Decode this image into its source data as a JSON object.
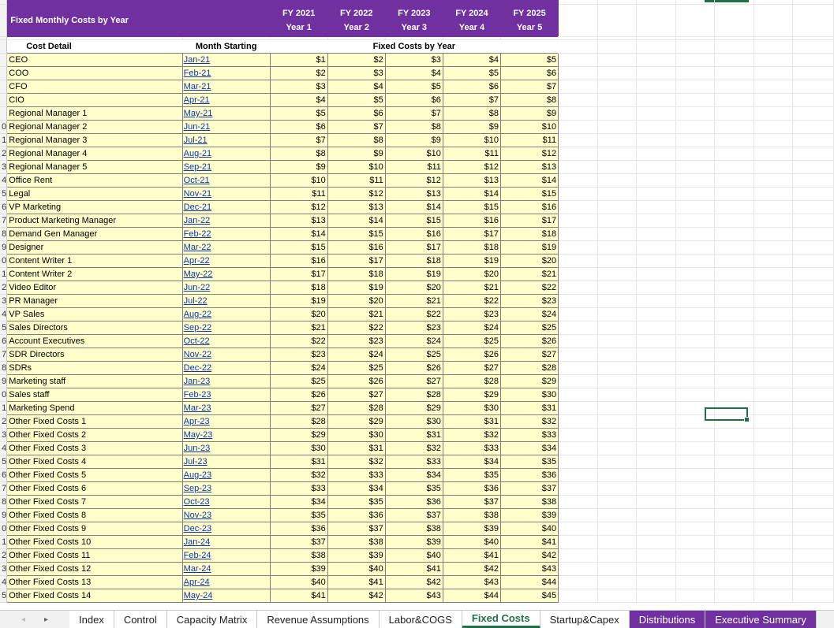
{
  "header": {
    "title": "Fixed Monthly Costs by Year",
    "fy": [
      "FY 2021",
      "FY 2022",
      "FY 2023",
      "FY 2024",
      "FY 2025"
    ],
    "years": [
      "Year 1",
      "Year 2",
      "Year 3",
      "Year 4",
      "Year 5"
    ]
  },
  "subheader": {
    "cost_detail": "Cost Detail",
    "month_starting": "Month Starting",
    "fixed_costs_by_year": "Fixed Costs by Year"
  },
  "row_numbers": [
    "",
    "",
    "",
    "",
    "",
    "",
    "",
    "0",
    "1",
    "2",
    "3",
    "4",
    "5",
    "6",
    "7",
    "8",
    "9",
    "0",
    "1",
    "2",
    "3",
    "4",
    "5",
    "6",
    "7",
    "8",
    "9",
    "0",
    "1",
    "2",
    "3",
    "4",
    "5",
    "6",
    "7",
    "8",
    "9",
    "0",
    "1",
    "2",
    "3",
    "4",
    "5"
  ],
  "rows": [
    {
      "label": "CEO",
      "month": "Jan-21",
      "v": [
        "$1",
        "$2",
        "$3",
        "$4",
        "$5"
      ]
    },
    {
      "label": "COO",
      "month": "Feb-21",
      "v": [
        "$2",
        "$3",
        "$4",
        "$5",
        "$6"
      ]
    },
    {
      "label": "CFO",
      "month": "Mar-21",
      "v": [
        "$3",
        "$4",
        "$5",
        "$6",
        "$7"
      ]
    },
    {
      "label": "CIO",
      "month": "Apr-21",
      "v": [
        "$4",
        "$5",
        "$6",
        "$7",
        "$8"
      ]
    },
    {
      "label": "Regional Manager 1",
      "month": "May-21",
      "v": [
        "$5",
        "$6",
        "$7",
        "$8",
        "$9"
      ]
    },
    {
      "label": "Regional Manager 2",
      "month": "Jun-21",
      "v": [
        "$6",
        "$7",
        "$8",
        "$9",
        "$10"
      ]
    },
    {
      "label": "Regional Manager 3",
      "month": "Jul-21",
      "v": [
        "$7",
        "$8",
        "$9",
        "$10",
        "$11"
      ]
    },
    {
      "label": "Regional Manager 4",
      "month": "Aug-21",
      "v": [
        "$8",
        "$9",
        "$10",
        "$11",
        "$12"
      ]
    },
    {
      "label": "Regional Manager 5",
      "month": "Sep-21",
      "v": [
        "$9",
        "$10",
        "$11",
        "$12",
        "$13"
      ]
    },
    {
      "label": "Office Rent",
      "month": "Oct-21",
      "v": [
        "$10",
        "$11",
        "$12",
        "$13",
        "$14"
      ]
    },
    {
      "label": "Legal",
      "month": "Nov-21",
      "v": [
        "$11",
        "$12",
        "$13",
        "$14",
        "$15"
      ]
    },
    {
      "label": "VP Marketing",
      "month": "Dec-21",
      "v": [
        "$12",
        "$13",
        "$14",
        "$15",
        "$16"
      ]
    },
    {
      "label": "Product Marketing Manager",
      "month": "Jan-22",
      "v": [
        "$13",
        "$14",
        "$15",
        "$16",
        "$17"
      ]
    },
    {
      "label": "Demand Gen Manager",
      "month": "Feb-22",
      "v": [
        "$14",
        "$15",
        "$16",
        "$17",
        "$18"
      ]
    },
    {
      "label": "Designer",
      "month": "Mar-22",
      "v": [
        "$15",
        "$16",
        "$17",
        "$18",
        "$19"
      ]
    },
    {
      "label": "Content Writer 1",
      "month": "Apr-22",
      "v": [
        "$16",
        "$17",
        "$18",
        "$19",
        "$20"
      ]
    },
    {
      "label": "Content Writer 2",
      "month": "May-22",
      "v": [
        "$17",
        "$18",
        "$19",
        "$20",
        "$21"
      ]
    },
    {
      "label": "Video Editor",
      "month": "Jun-22",
      "v": [
        "$18",
        "$19",
        "$20",
        "$21",
        "$22"
      ]
    },
    {
      "label": "PR Manager",
      "month": "Jul-22",
      "v": [
        "$19",
        "$20",
        "$21",
        "$22",
        "$23"
      ]
    },
    {
      "label": "VP Sales",
      "month": "Aug-22",
      "v": [
        "$20",
        "$21",
        "$22",
        "$23",
        "$24"
      ]
    },
    {
      "label": "Sales Directors",
      "month": "Sep-22",
      "v": [
        "$21",
        "$22",
        "$23",
        "$24",
        "$25"
      ]
    },
    {
      "label": "Account Executives",
      "month": "Oct-22",
      "v": [
        "$22",
        "$23",
        "$24",
        "$25",
        "$26"
      ]
    },
    {
      "label": "SDR Directors",
      "month": "Nov-22",
      "v": [
        "$23",
        "$24",
        "$25",
        "$26",
        "$27"
      ]
    },
    {
      "label": "SDRs",
      "month": "Dec-22",
      "v": [
        "$24",
        "$25",
        "$26",
        "$27",
        "$28"
      ]
    },
    {
      "label": "Marketing staff",
      "month": "Jan-23",
      "v": [
        "$25",
        "$26",
        "$27",
        "$28",
        "$29"
      ]
    },
    {
      "label": "Sales staff",
      "month": "Feb-23",
      "v": [
        "$26",
        "$27",
        "$28",
        "$29",
        "$30"
      ]
    },
    {
      "label": "Marketing Spend",
      "month": "Mar-23",
      "v": [
        "$27",
        "$28",
        "$29",
        "$30",
        "$31"
      ]
    },
    {
      "label": "Other Fixed Costs 1",
      "month": "Apr-23",
      "v": [
        "$28",
        "$29",
        "$30",
        "$31",
        "$32"
      ]
    },
    {
      "label": "Other Fixed Costs 2",
      "month": "May-23",
      "v": [
        "$29",
        "$30",
        "$31",
        "$32",
        "$33"
      ]
    },
    {
      "label": "Other Fixed Costs 3",
      "month": "Jun-23",
      "v": [
        "$30",
        "$31",
        "$32",
        "$33",
        "$34"
      ]
    },
    {
      "label": "Other Fixed Costs 4",
      "month": "Jul-23",
      "v": [
        "$31",
        "$32",
        "$33",
        "$34",
        "$35"
      ]
    },
    {
      "label": "Other Fixed Costs 5",
      "month": "Aug-23",
      "v": [
        "$32",
        "$33",
        "$34",
        "$35",
        "$36"
      ]
    },
    {
      "label": "Other Fixed Costs 6",
      "month": "Sep-23",
      "v": [
        "$33",
        "$34",
        "$35",
        "$36",
        "$37"
      ]
    },
    {
      "label": "Other Fixed Costs 7",
      "month": "Oct-23",
      "v": [
        "$34",
        "$35",
        "$36",
        "$37",
        "$38"
      ]
    },
    {
      "label": "Other Fixed Costs 8",
      "month": "Nov-23",
      "v": [
        "$35",
        "$36",
        "$37",
        "$38",
        "$39"
      ]
    },
    {
      "label": "Other Fixed Costs 9",
      "month": "Dec-23",
      "v": [
        "$36",
        "$37",
        "$38",
        "$39",
        "$40"
      ]
    },
    {
      "label": "Other Fixed Costs 10",
      "month": "Jan-24",
      "v": [
        "$37",
        "$38",
        "$39",
        "$40",
        "$41"
      ]
    },
    {
      "label": "Other Fixed Costs 11",
      "month": "Feb-24",
      "v": [
        "$38",
        "$39",
        "$40",
        "$41",
        "$42"
      ]
    },
    {
      "label": "Other Fixed Costs 12",
      "month": "Mar-24",
      "v": [
        "$39",
        "$40",
        "$41",
        "$42",
        "$43"
      ]
    },
    {
      "label": "Other Fixed Costs 13",
      "month": "Apr-24",
      "v": [
        "$40",
        "$41",
        "$42",
        "$43",
        "$44"
      ]
    },
    {
      "label": "Other Fixed Costs 14",
      "month": "May-24",
      "v": [
        "$41",
        "$42",
        "$43",
        "$44",
        "$45"
      ]
    }
  ],
  "tabs": [
    {
      "label": "Index",
      "style": "normal"
    },
    {
      "label": "Control",
      "style": "normal"
    },
    {
      "label": "Capacity Matrix",
      "style": "normal"
    },
    {
      "label": "Revenue Assumptions",
      "style": "normal"
    },
    {
      "label": "Labor&COGS",
      "style": "normal"
    },
    {
      "label": "Fixed Costs",
      "style": "active"
    },
    {
      "label": "Startup&Capex",
      "style": "normal"
    },
    {
      "label": "Distributions",
      "style": "purple"
    },
    {
      "label": "Executive Summary",
      "style": "purple"
    }
  ],
  "nav": {
    "prev_icon": "arrow-left-icon",
    "next_icon": "arrow-right-icon",
    "next_glyph": "▸"
  }
}
